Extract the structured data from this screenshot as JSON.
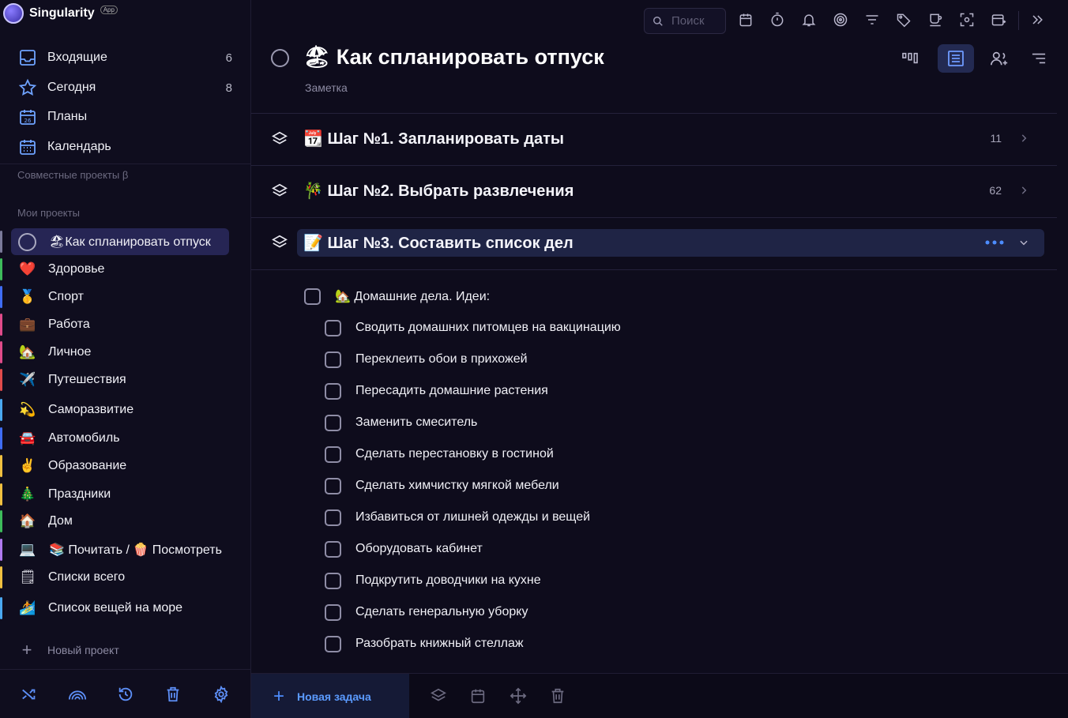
{
  "app": {
    "name": "Singularity",
    "badge": "App"
  },
  "sidebar": {
    "nav": [
      {
        "label": "Входящие",
        "count": "6",
        "icon": "inbox-icon"
      },
      {
        "label": "Сегодня",
        "count": "8",
        "icon": "star-icon"
      },
      {
        "label": "Планы",
        "count": "",
        "icon": "calendar-day-icon"
      },
      {
        "label": "Календарь",
        "count": "",
        "icon": "calendar-grid-icon"
      }
    ],
    "shared_projects_title": "Совместные проекты β",
    "my_projects_title": "Мои проекты",
    "projects": [
      {
        "emoji": "🏖",
        "label": "Как спланировать отпуск",
        "color": "#7a7a9a",
        "active": true
      },
      {
        "emoji": "❤️",
        "label": "Здоровье",
        "color": "#3dbb5b"
      },
      {
        "emoji": "🥇",
        "label": "Спорт",
        "color": "#3f6df5"
      },
      {
        "emoji": "💼",
        "label": "Работа",
        "color": "#e04b8a"
      },
      {
        "emoji": "🏡",
        "label": "Личное",
        "color": "#e04b8a"
      },
      {
        "emoji": "✈️",
        "label": "Путешествия",
        "color": "#e04b4b"
      },
      {
        "emoji": "💫",
        "label": "Саморазвитие",
        "color": "#4aa8f0"
      },
      {
        "emoji": "🚘",
        "label": "Автомобиль",
        "color": "#3f6df5"
      },
      {
        "emoji": "✌️",
        "label": "Образование",
        "color": "#f0c040"
      },
      {
        "emoji": "🎄",
        "label": "Праздники",
        "color": "#f0c040"
      },
      {
        "emoji": "🏠",
        "label": "Дом",
        "color": "#3dbb5b"
      },
      {
        "emoji": "💻",
        "label": "📚 Почитать / 🍿 Посмотреть",
        "color": "#b07af0"
      },
      {
        "emoji": "🗒",
        "label": "Списки всего",
        "color": "#f0c040"
      },
      {
        "emoji": "🏄",
        "label": "Список вещей на море",
        "color": "#4aa8f0"
      }
    ],
    "new_project": "Новый проект",
    "footer_icons": [
      "shuffle-icon",
      "rainbow-icon",
      "history-icon",
      "trash-icon",
      "gear-icon"
    ]
  },
  "toolbar": {
    "search_placeholder": "Поиск",
    "icons": [
      "calendar-icon",
      "timer-icon",
      "bell-icon",
      "target-icon",
      "filter-icon",
      "tag-icon",
      "coffee-icon",
      "focus-icon",
      "calendar-add-icon",
      "collapse-icon"
    ]
  },
  "main": {
    "title": "🏖 Как спланировать отпуск",
    "subtitle": "Заметка",
    "steps": [
      {
        "title": "📆 Шаг №1. Запланировать даты",
        "count": "11"
      },
      {
        "title": "🎋 Шаг №2. Выбрать развлечения",
        "count": "62"
      },
      {
        "title": "📝 Шаг №3. Составить список дел",
        "count": ""
      }
    ],
    "parent_task": "🏡 Домашние дела. Идеи:",
    "subtasks": [
      "Сводить домашних питомцев на вакцинацию",
      "Переклеить обои в прихожей",
      "Пересадить домашние растения",
      "Заменить смеситель",
      "Сделать перестановку в гостиной",
      "Сделать химчистку мягкой мебели",
      "Избавиться от лишней одежды и вещей",
      "Оборудовать кабинет",
      "Подкрутить доводчики на кухне",
      "Сделать генеральную уборку",
      "Разобрать книжный стеллаж"
    ]
  },
  "bottom": {
    "new_task": "Новая задача"
  },
  "colors": {
    "accent": "#4d8dff",
    "background": "#0e0c1c",
    "active_row": "#262554"
  }
}
